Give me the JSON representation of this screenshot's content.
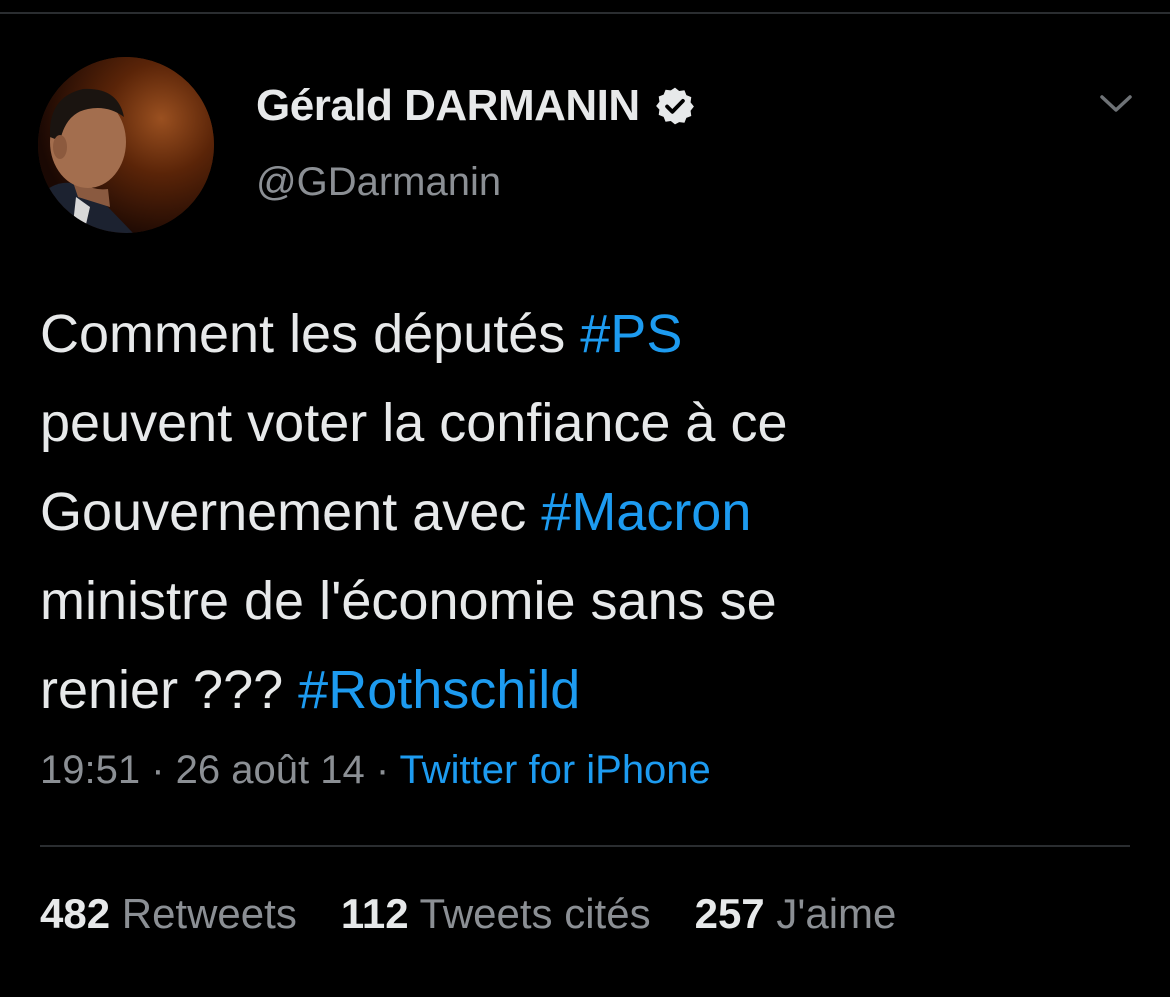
{
  "author": {
    "display_name": "Gérald DARMANIN",
    "handle": "@GDarmanin",
    "verified_icon": "verified-badge-icon",
    "menu_icon": "chevron-down-icon"
  },
  "tweet": {
    "lines": [
      [
        {
          "text": "Comment les députés ",
          "type": "text"
        },
        {
          "text": "#PS",
          "type": "hashtag"
        }
      ],
      [
        {
          "text": "peuvent voter la confiance à ce",
          "type": "text"
        }
      ],
      [
        {
          "text": "Gouvernement avec ",
          "type": "text"
        },
        {
          "text": "#Macron",
          "type": "hashtag"
        }
      ],
      [
        {
          "text": "ministre de l'économie sans se",
          "type": "text"
        }
      ],
      [
        {
          "text": "renier ??? ",
          "type": "text"
        },
        {
          "text": "#Rothschild",
          "type": "hashtag"
        }
      ]
    ]
  },
  "meta": {
    "time": "19:51",
    "separator": " · ",
    "date": "26 août 14",
    "source": "Twitter for iPhone"
  },
  "stats": {
    "retweets_count": "482",
    "retweets_label": " Retweets",
    "quotes_count": "112",
    "quotes_label": " Tweets cités",
    "likes_count": "257",
    "likes_label": " J'aime"
  },
  "colors": {
    "background": "#000000",
    "text": "#e7e9ea",
    "secondary_text": "#8b8f94",
    "link": "#1d9bf0"
  }
}
